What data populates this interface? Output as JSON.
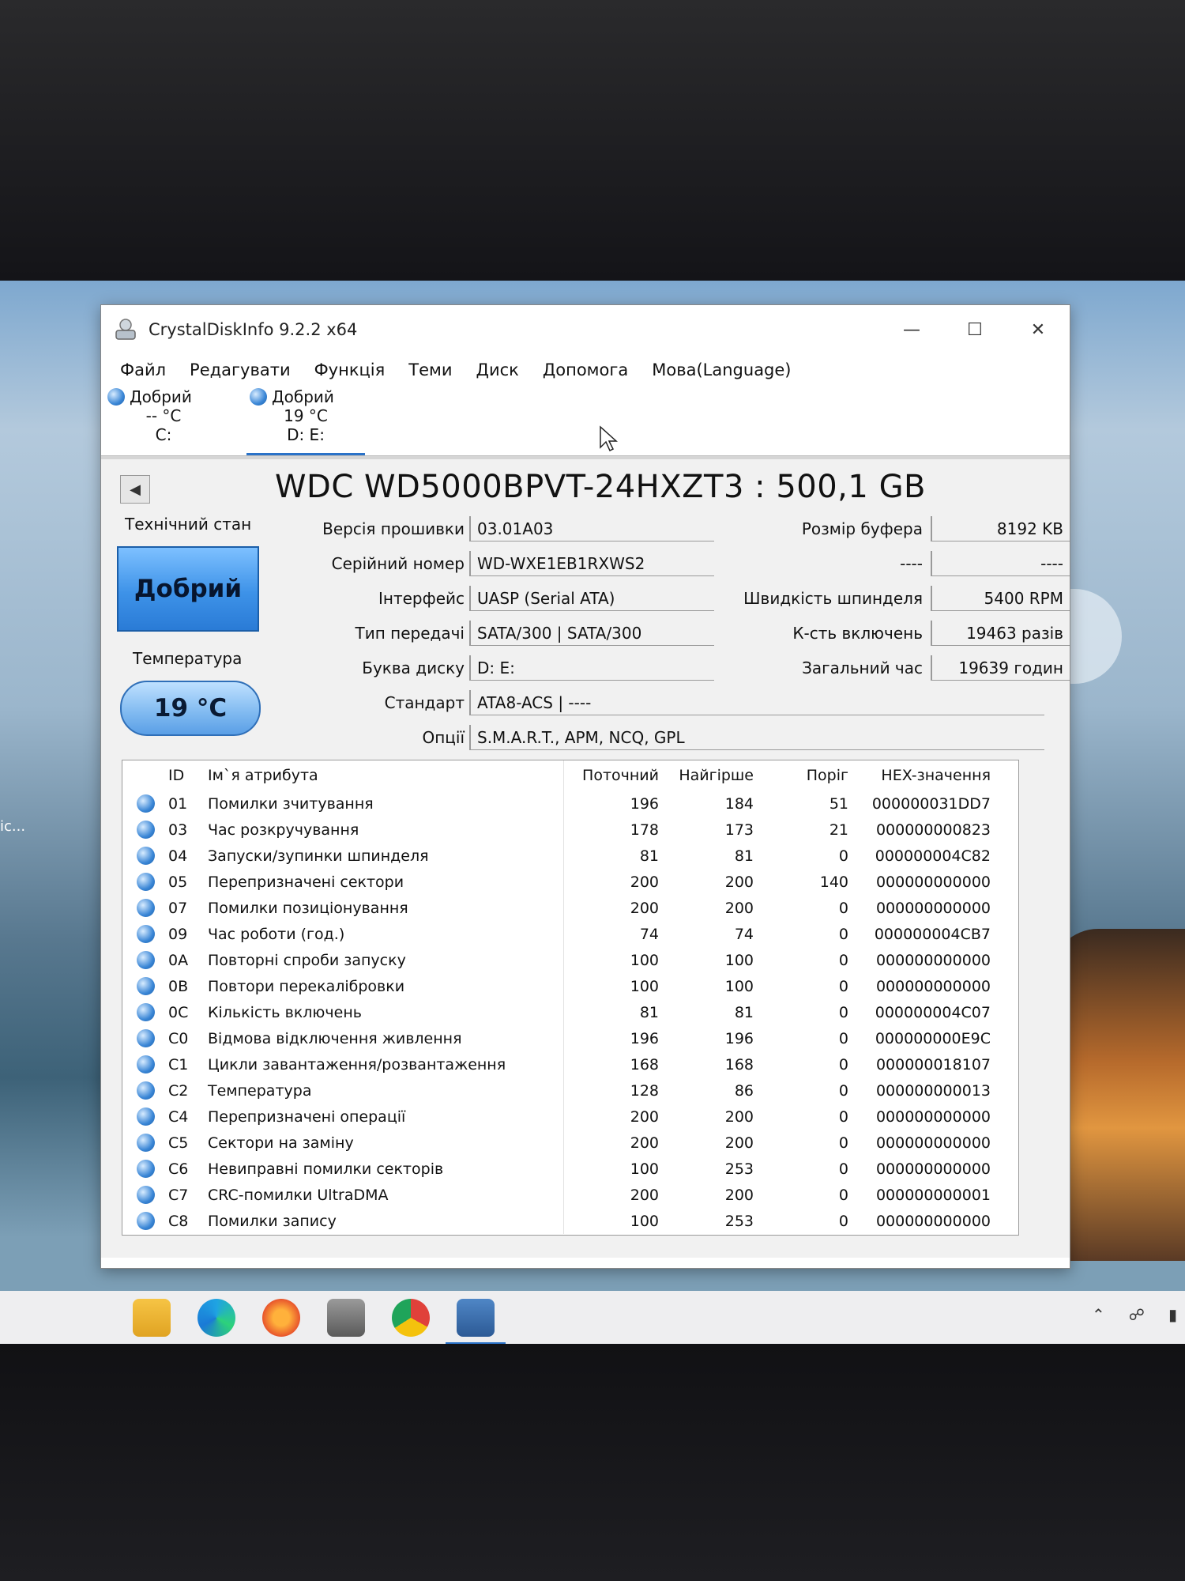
{
  "window": {
    "title": "CrystalDiskInfo 9.2.2 x64"
  },
  "menu": [
    "Файл",
    "Редагувати",
    "Функція",
    "Теми",
    "Диск",
    "Допомога",
    "Мова(Language)"
  ],
  "drives": [
    {
      "status": "Добрий",
      "temp": "-- °C",
      "letter": "C:"
    },
    {
      "status": "Добрий",
      "temp": "19 °C",
      "letter": "D: E:"
    }
  ],
  "disk": {
    "model": "WDC WD5000BPVT-24HXZT3 : 500,1 GB",
    "health_label": "Технічний стан",
    "health_value": "Добрий",
    "temp_label": "Температура",
    "temp_value": "19 °C"
  },
  "info_left": [
    {
      "label": "Версія прошивки",
      "value": "03.01A03"
    },
    {
      "label": "Серійний номер",
      "value": "WD-WXE1EB1RXWS2"
    },
    {
      "label": "Інтерфейс",
      "value": "UASP (Serial ATA)"
    },
    {
      "label": "Тип передачі",
      "value": "SATA/300 | SATA/300"
    },
    {
      "label": "Буква диску",
      "value": "D: E:"
    },
    {
      "label": "Стандарт",
      "value": "ATA8-ACS | ----"
    },
    {
      "label": "Опції",
      "value": "S.M.A.R.T., APM, NCQ, GPL"
    }
  ],
  "info_right": [
    {
      "label": "Розмір буфера",
      "value": "8192 KB"
    },
    {
      "label": "----",
      "value": "----"
    },
    {
      "label": "Швидкість шпинделя",
      "value": "5400 RPM"
    },
    {
      "label": "К-сть включень",
      "value": "19463 разів"
    },
    {
      "label": "Загальний час",
      "value": "19639 годин"
    }
  ],
  "table": {
    "headers": {
      "id": "ID",
      "name": "Ім`я атрибута",
      "current": "Поточний",
      "worst": "Найгірше",
      "threshold": "Поріг",
      "hex": "HEX-значення"
    },
    "rows": [
      {
        "id": "01",
        "name": "Помилки зчитування",
        "current": "196",
        "worst": "184",
        "threshold": "51",
        "hex": "000000031DD7"
      },
      {
        "id": "03",
        "name": "Час розкручування",
        "current": "178",
        "worst": "173",
        "threshold": "21",
        "hex": "000000000823"
      },
      {
        "id": "04",
        "name": "Запуски/зупинки шпинделя",
        "current": "81",
        "worst": "81",
        "threshold": "0",
        "hex": "000000004C82"
      },
      {
        "id": "05",
        "name": "Перепризначені сектори",
        "current": "200",
        "worst": "200",
        "threshold": "140",
        "hex": "000000000000"
      },
      {
        "id": "07",
        "name": "Помилки позиціонування",
        "current": "200",
        "worst": "200",
        "threshold": "0",
        "hex": "000000000000"
      },
      {
        "id": "09",
        "name": "Час роботи (год.)",
        "current": "74",
        "worst": "74",
        "threshold": "0",
        "hex": "000000004CB7"
      },
      {
        "id": "0A",
        "name": "Повторні спроби запуску",
        "current": "100",
        "worst": "100",
        "threshold": "0",
        "hex": "000000000000"
      },
      {
        "id": "0B",
        "name": "Повтори перекалібровки",
        "current": "100",
        "worst": "100",
        "threshold": "0",
        "hex": "000000000000"
      },
      {
        "id": "0C",
        "name": "Кількість включень",
        "current": "81",
        "worst": "81",
        "threshold": "0",
        "hex": "000000004C07"
      },
      {
        "id": "C0",
        "name": "Відмова відключення живлення",
        "current": "196",
        "worst": "196",
        "threshold": "0",
        "hex": "000000000E9C"
      },
      {
        "id": "C1",
        "name": "Цикли завантаження/розвантаження",
        "current": "168",
        "worst": "168",
        "threshold": "0",
        "hex": "000000018107"
      },
      {
        "id": "C2",
        "name": "Температура",
        "current": "128",
        "worst": "86",
        "threshold": "0",
        "hex": "000000000013"
      },
      {
        "id": "C4",
        "name": "Перепризначені операції",
        "current": "200",
        "worst": "200",
        "threshold": "0",
        "hex": "000000000000"
      },
      {
        "id": "C5",
        "name": "Сектори на заміну",
        "current": "200",
        "worst": "200",
        "threshold": "0",
        "hex": "000000000000"
      },
      {
        "id": "C6",
        "name": "Невиправні помилки секторів",
        "current": "100",
        "worst": "253",
        "threshold": "0",
        "hex": "000000000000"
      },
      {
        "id": "C7",
        "name": "CRC-помилки UltraDMA",
        "current": "200",
        "worst": "200",
        "threshold": "0",
        "hex": "000000000001"
      },
      {
        "id": "C8",
        "name": "Помилки запису",
        "current": "100",
        "worst": "253",
        "threshold": "0",
        "hex": "000000000000"
      }
    ]
  },
  "desktop": {
    "icon_label": "ic..."
  },
  "colors": {
    "good_blue": "#3d92e8",
    "taskbar": "#eeeef0"
  }
}
